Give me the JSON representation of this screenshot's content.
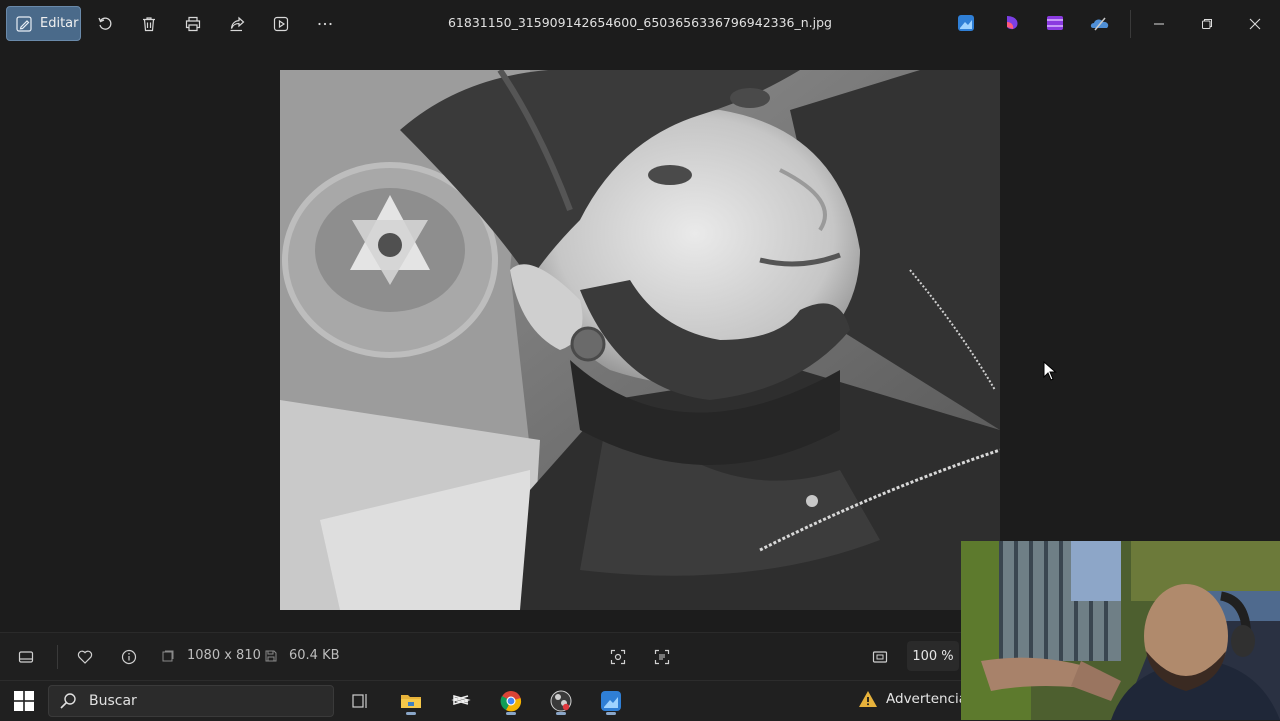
{
  "toolbar": {
    "edit_label": "Editar",
    "icons": [
      "edit-icon",
      "rotate-icon",
      "delete-icon",
      "print-icon",
      "share-icon",
      "slideshow-icon",
      "more-icon"
    ]
  },
  "title": {
    "filename": "61831150_315909142654600_6503656336796942336_n.jpg"
  },
  "window_controls": [
    "minimize-icon",
    "restore-icon",
    "close-icon"
  ],
  "info_bar": {
    "dimensions": "1080 x 810",
    "file_size": "60.4 KB",
    "zoom": "100 %"
  },
  "taskbar": {
    "search_placeholder": "Buscar",
    "warning_label": "Advertencia"
  },
  "colors": {
    "background": "#1c1c1c",
    "edit_button": "#4a6a8a",
    "taskbar": "#202020"
  }
}
